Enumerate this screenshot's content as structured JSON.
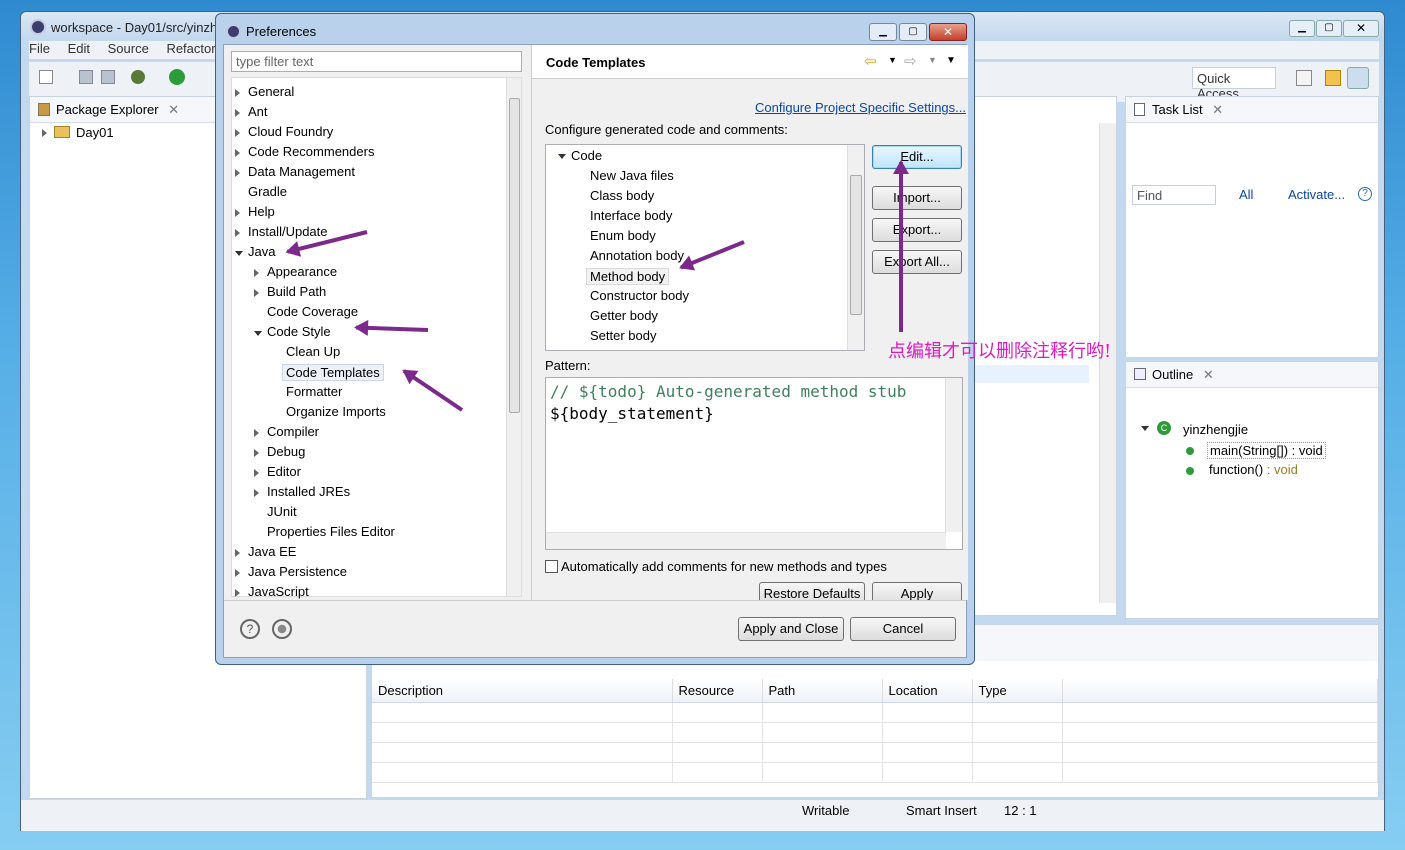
{
  "workbench": {
    "title": "workspace - Day01/src/yinzh",
    "menu": [
      "File",
      "Edit",
      "Source",
      "Refactor"
    ],
    "quick_access": "Quick Access",
    "package_explorer": {
      "tab": "Package Explorer",
      "project": "Day01"
    },
    "task_list": {
      "tab": "Task List",
      "find_placeholder": "Find",
      "all": "All",
      "activate": "Activate..."
    },
    "outline": {
      "tab": "Outline",
      "class": "yinzhengjie",
      "members": [
        {
          "name": "main(String[]) : void"
        },
        {
          "name": "function()",
          "type": " : void"
        }
      ]
    },
    "problems": {
      "columns": [
        "Description",
        "Resource",
        "Path",
        "Location",
        "Type"
      ]
    },
    "status": {
      "writable": "Writable",
      "insert": "Smart Insert",
      "position": "12 : 1"
    }
  },
  "dialog": {
    "title": "Preferences",
    "filter_placeholder": "type filter text",
    "tree": [
      {
        "label": "General",
        "level": 0,
        "expander": "closed"
      },
      {
        "label": "Ant",
        "level": 0,
        "expander": "closed"
      },
      {
        "label": "Cloud Foundry",
        "level": 0,
        "expander": "closed"
      },
      {
        "label": "Code Recommenders",
        "level": 0,
        "expander": "closed"
      },
      {
        "label": "Data Management",
        "level": 0,
        "expander": "closed"
      },
      {
        "label": "Gradle",
        "level": 0,
        "expander": "none"
      },
      {
        "label": "Help",
        "level": 0,
        "expander": "closed"
      },
      {
        "label": "Install/Update",
        "level": 0,
        "expander": "closed"
      },
      {
        "label": "Java",
        "level": 0,
        "expander": "open"
      },
      {
        "label": "Appearance",
        "level": 1,
        "expander": "closed"
      },
      {
        "label": "Build Path",
        "level": 1,
        "expander": "closed"
      },
      {
        "label": "Code Coverage",
        "level": 1,
        "expander": "none"
      },
      {
        "label": "Code Style",
        "level": 1,
        "expander": "open"
      },
      {
        "label": "Clean Up",
        "level": 2,
        "expander": "none"
      },
      {
        "label": "Code Templates",
        "level": 2,
        "expander": "none",
        "selected": true
      },
      {
        "label": "Formatter",
        "level": 2,
        "expander": "none"
      },
      {
        "label": "Organize Imports",
        "level": 2,
        "expander": "none"
      },
      {
        "label": "Compiler",
        "level": 1,
        "expander": "closed"
      },
      {
        "label": "Debug",
        "level": 1,
        "expander": "closed"
      },
      {
        "label": "Editor",
        "level": 1,
        "expander": "closed"
      },
      {
        "label": "Installed JREs",
        "level": 1,
        "expander": "closed"
      },
      {
        "label": "JUnit",
        "level": 1,
        "expander": "none"
      },
      {
        "label": "Properties Files Editor",
        "level": 1,
        "expander": "none"
      },
      {
        "label": "Java EE",
        "level": 0,
        "expander": "closed"
      },
      {
        "label": "Java Persistence",
        "level": 0,
        "expander": "closed"
      },
      {
        "label": "JavaScript",
        "level": 0,
        "expander": "closed"
      }
    ],
    "page_title": "Code Templates",
    "configure_link": "Configure Project Specific Settings...",
    "configure_label": "Configure generated code and comments:",
    "templates_root": "Code",
    "templates": [
      "New Java files",
      "Class body",
      "Interface body",
      "Enum body",
      "Annotation body",
      "Method body",
      "Constructor body",
      "Getter body",
      "Setter body"
    ],
    "selected_template": "Method body",
    "buttons": {
      "edit": "Edit...",
      "import": "Import...",
      "export": "Export...",
      "export_all": "Export All...",
      "restore": "Restore Defaults",
      "apply": "Apply",
      "apply_close": "Apply and Close",
      "cancel": "Cancel"
    },
    "pattern_label": "Pattern:",
    "pattern_line1": "// ${todo} Auto-generated method stub",
    "pattern_line2": "${body_statement}",
    "auto_comments": "Automatically add comments for new methods and types",
    "auto_comments_checked": false
  },
  "annotation": "点编辑才可以删除注释行哟!"
}
